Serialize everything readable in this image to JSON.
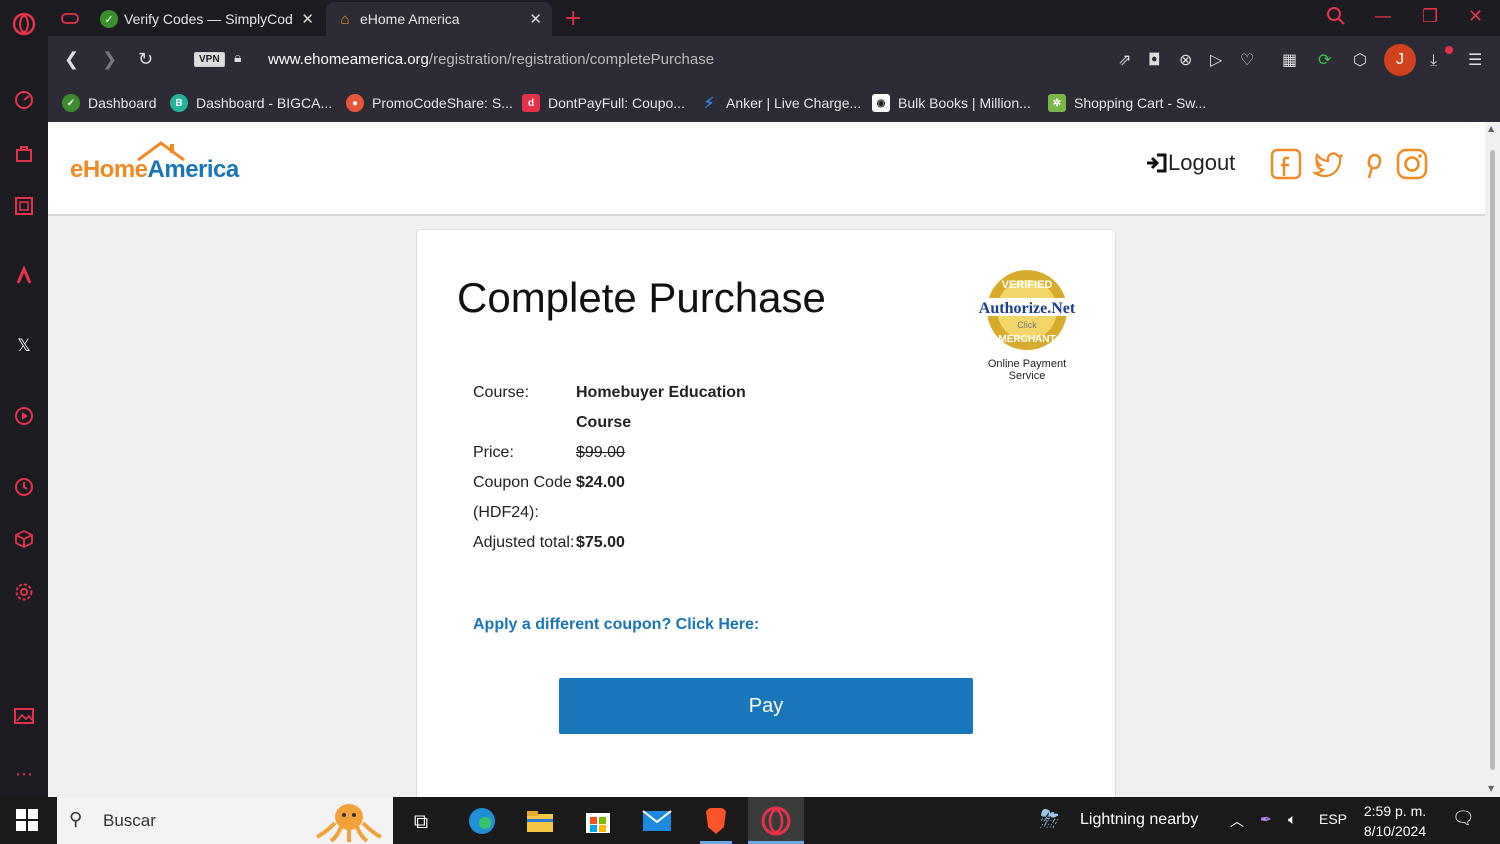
{
  "browser": {
    "tabs": [
      {
        "label": "Verify Codes — SimplyCod",
        "active": false
      },
      {
        "label": "eHome America",
        "active": true
      }
    ],
    "url_domain": "www.ehomeamerica.org",
    "url_path": "/registration/registration/completePurchase",
    "vpn_label": "VPN",
    "avatar_letter": "J",
    "bookmarks": [
      {
        "label": "Dashboard",
        "color": "#3a8f2a"
      },
      {
        "label": "Dashboard - BIGCA...",
        "color": "#23b39a"
      },
      {
        "label": "PromoCodeShare: S...",
        "color": "#e8553b"
      },
      {
        "label": "DontPayFull: Coupo...",
        "color": "#e5324a"
      },
      {
        "label": "Anker | Live Charge...",
        "color": "#2f7ee5"
      },
      {
        "label": "Bulk Books | Million...",
        "color": "#ffffff"
      },
      {
        "label": "Shopping Cart - Sw...",
        "color": "#7ab648"
      }
    ]
  },
  "site": {
    "logo_part1": "eHome",
    "logo_part2": "America",
    "logout_label": "Logout",
    "brand_orange": "#f08a24",
    "brand_blue": "#1976ba"
  },
  "purchase": {
    "title": "Complete Purchase",
    "seal_text": "Online Payment Service",
    "seal_brand": "Authorize.Net",
    "seal_verified": "VERIFIED",
    "seal_merchant": "MERCHANT",
    "seal_click": "Click",
    "rows": [
      {
        "label": "Course:",
        "value": "Homebuyer Education Course"
      },
      {
        "label": "Price:",
        "value": "$99.00"
      },
      {
        "label": "Coupon Code (HDF24):",
        "value": "$24.00"
      },
      {
        "label": "Adjusted total:",
        "value": "$75.00"
      }
    ],
    "apply_link": "Apply a different coupon? Click Here:",
    "pay_label": "Pay"
  },
  "taskbar": {
    "search_label": "Buscar",
    "weather": "Lightning nearby",
    "language": "ESP",
    "time": "2:59 p. m.",
    "date": "8/10/2024"
  }
}
